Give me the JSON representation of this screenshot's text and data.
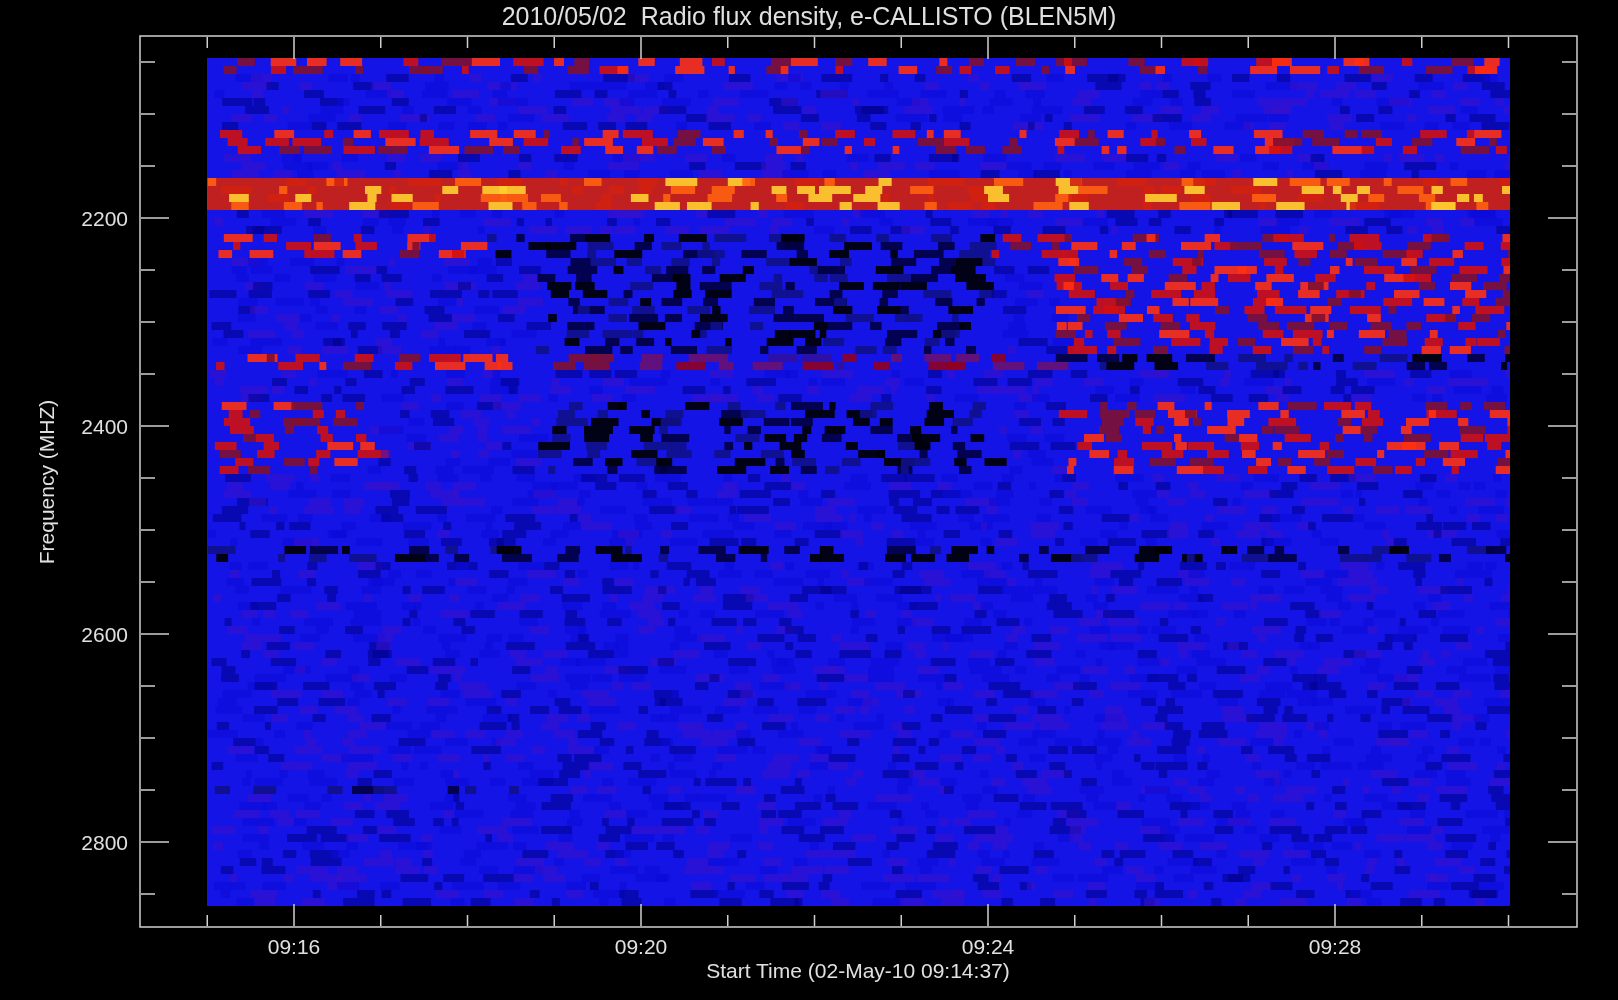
{
  "chart": {
    "title": "2010/05/02  Radio flux density, e-CALLISTO (BLEN5M)",
    "ylabel": "Frequency (MHZ)",
    "xlabel": "Start Time (02-May-10 09:14:37)",
    "yticks": [
      "2200",
      "2400",
      "2600",
      "2800"
    ],
    "xticks": [
      "09:16",
      "09:20",
      "09:24",
      "09:28"
    ]
  }
}
